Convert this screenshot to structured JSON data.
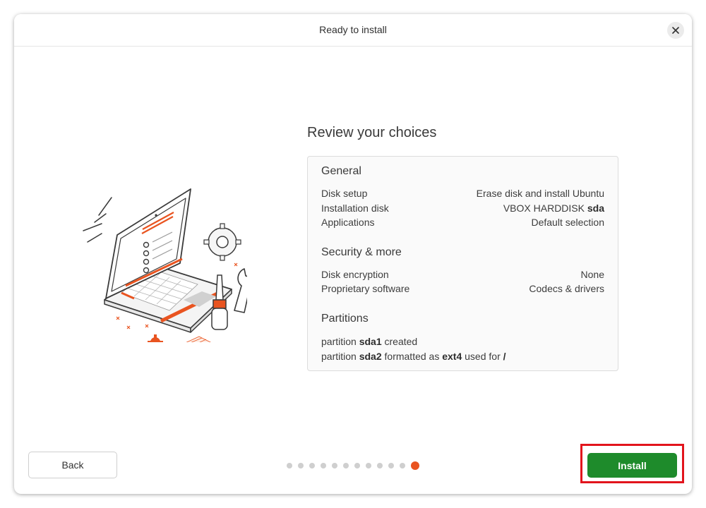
{
  "window": {
    "title": "Ready to install"
  },
  "main": {
    "heading": "Review your choices",
    "general": {
      "title": "General",
      "rows": [
        {
          "label": "Disk setup",
          "value": "Erase disk and install Ubuntu"
        },
        {
          "label": "Installation disk",
          "value_prefix": "VBOX HARDDISK ",
          "value_bold": "sda"
        },
        {
          "label": "Applications",
          "value": "Default selection"
        }
      ]
    },
    "security": {
      "title": "Security & more",
      "rows": [
        {
          "label": "Disk encryption",
          "value": "None"
        },
        {
          "label": "Proprietary software",
          "value": "Codecs & drivers"
        }
      ]
    },
    "partitions": {
      "title": "Partitions",
      "line1": {
        "a": "partition ",
        "b": "sda1",
        "c": " created"
      },
      "line2": {
        "a": "partition ",
        "b": "sda2",
        "c": " formatted as ",
        "d": "ext4",
        "e": " used for ",
        "f": "/"
      }
    }
  },
  "footer": {
    "back_label": "Back",
    "install_label": "Install",
    "progress": {
      "total_steps": 12,
      "current_step": 12
    }
  },
  "colors": {
    "accent": "#e95420",
    "install": "#1e8b2b",
    "highlight": "#e2141c"
  },
  "icons": {
    "close": "close-icon",
    "illustration": "laptop-tools-illustration"
  }
}
